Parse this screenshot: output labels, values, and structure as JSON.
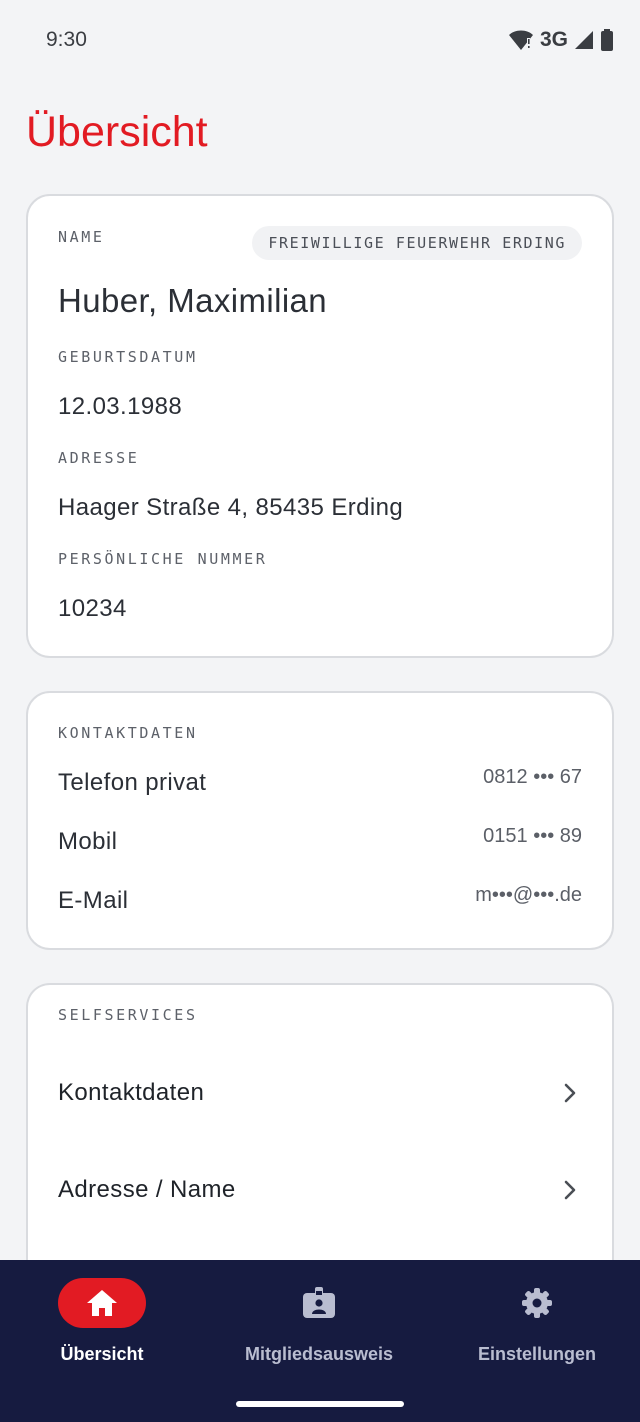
{
  "status_bar": {
    "time": "9:30",
    "network": "3G"
  },
  "page": {
    "title": "Übersicht"
  },
  "personal": {
    "name_label": "NAME",
    "organization": "FREIWILLIGE FEUERWEHR ERDING",
    "name": "Huber, Maximilian",
    "birthdate_label": "GEBURTSDATUM",
    "birthdate": "12.03.1988",
    "address_label": "ADRESSE",
    "address": "Haager Straße 4, 85435 Erding",
    "number_label": "PERSÖNLICHE NUMMER",
    "number": "10234"
  },
  "contact": {
    "header": "KONTAKTDATEN",
    "rows": [
      {
        "label": "Telefon privat",
        "value": "0812 ••• 67"
      },
      {
        "label": "Mobil",
        "value": "0151 ••• 89"
      },
      {
        "label": "E-Mail",
        "value": "m•••@•••.de"
      }
    ]
  },
  "selfservices": {
    "header": "SELFSERVICES",
    "items": [
      {
        "label": "Kontaktdaten"
      },
      {
        "label": "Adresse / Name"
      }
    ]
  },
  "nav": {
    "items": [
      {
        "label": "Übersicht",
        "icon": "home-icon",
        "active": true
      },
      {
        "label": "Mitgliedsausweis",
        "icon": "id-card-icon",
        "active": false
      },
      {
        "label": "Einstellungen",
        "icon": "gear-icon",
        "active": false
      }
    ]
  },
  "colors": {
    "accent": "#e21b23",
    "nav_bg": "#161b40",
    "background": "#f3f4f6"
  }
}
